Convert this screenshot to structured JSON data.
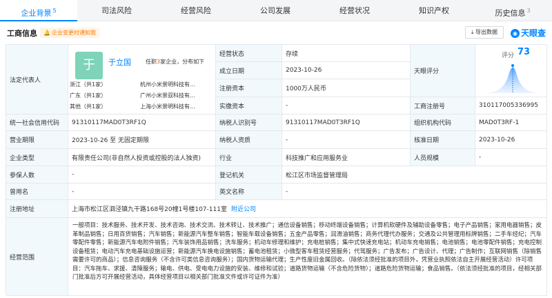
{
  "tabs": [
    {
      "label": "企业背景",
      "count": "5"
    },
    {
      "label": "司法风险",
      "count": ""
    },
    {
      "label": "经营风险",
      "count": ""
    },
    {
      "label": "公司发展",
      "count": ""
    },
    {
      "label": "经营状况",
      "count": ""
    },
    {
      "label": "知识产权",
      "count": ""
    },
    {
      "label": "历史信息",
      "count": "3"
    }
  ],
  "header": {
    "title": "工商信息",
    "subscribe": "企业变更时通知我",
    "export": "导出数据",
    "brand": "天眼查"
  },
  "legal_rep": {
    "label": "法定代表人",
    "avatar_char": "于",
    "name": "于立国",
    "roles_prefix": "任职",
    "roles_count": "3",
    "roles_suffix": "家企业，分布如下",
    "regions": [
      {
        "region": "浙江（共1家）",
        "company": "杭州小米景明科技有..."
      },
      {
        "region": "广东（共1家）",
        "company": "广州小米景驭科技有..."
      },
      {
        "region": "其他（共1家）",
        "company": "上海小米景明科技有..."
      }
    ]
  },
  "fields": {
    "status_label": "经营状态",
    "status": "存续",
    "est_label": "成立日期",
    "est": "2023-10-26",
    "capital_label": "注册资本",
    "capital": "1000万人民币",
    "paid_label": "实缴资本",
    "paid": "-",
    "score_label": "天眼评分",
    "score_caption": "评分",
    "score": "73",
    "reg_no_label": "工商注册号",
    "reg_no": "310117005336995",
    "credit_label": "统一社会信用代码",
    "credit": "91310117MAD0T3RF1Q",
    "tax_label": "纳税人识别号",
    "tax": "91310117MAD0T3RF1Q",
    "org_label": "组织机构代码",
    "org": "MAD0T3RF-1",
    "term_label": "营业期限",
    "term": "2023-10-26 至 无固定期限",
    "taxq_label": "纳税人资质",
    "taxq": "-",
    "approve_label": "核准日期",
    "approve": "2023-10-26",
    "type_label": "企业类型",
    "type": "有限责任公司(非自然人投资或控股的法人独资)",
    "industry_label": "行业",
    "industry": "科技推广和应用服务业",
    "staff_label": "人员规模",
    "staff": "-",
    "insured_label": "参保人数",
    "insured": "-",
    "authority_label": "登记机关",
    "authority": "松江区市场监督管理局",
    "former_label": "曾用名",
    "former": "-",
    "en_label": "英文名称",
    "en": "-",
    "address_label": "注册地址",
    "address": "上海市松江区泗泾镇九干路168号20幢1号楼107-111室",
    "address_link": "附近公司",
    "scope_label": "经营范围",
    "scope": "一般项目：技术服务、技术开发、技术咨询、技术交流、技术转让、技术推广；通信设备销售；移动终端设备销售；计算机软硬件及辅助设备零售；电子产品销售；家用电器销售；皮革制品销售；日用百货销售；汽车销售；新能源汽车整车销售；智能车载设备销售；五金产品零售；润滑油销售；商务代理代办服务；交通及公共管理用标牌销售；二手车经纪；汽车零配件零售；新能源汽车电附件销售；汽车装饰用品销售；洗车服务；机动车修理和维护；充电桩销售；集中式快速充电站；机动车充电销售；电池销售；电池零配件销售；充电控制设备租赁；电动汽车充电基础设施运营；新能源汽车换电设施销售；蓄电池租赁；小微型客车租赁经营服务；代驾服务；广告发布；广告设计、代理；广告制作；互联网销售（除销售需要许可的商品）；信息咨询服务（不含许可类信息咨询服务）；国内货物运输代理；生产性废旧金属回收。（除依法须经批准的项目外，凭营业执照依法自主开展经营活动）许可项目：汽车拖车、求援、清障服务；输电、供电、受电电力设施的安装、维修和试验；道路货物运输（不含危险货物）；道路危险货物运输；食品销售。（依法须经批准的项目，经相关部门批准后方可开展经营活动，具体经营项目以相关部门批准文件或许可证件为准）"
  }
}
